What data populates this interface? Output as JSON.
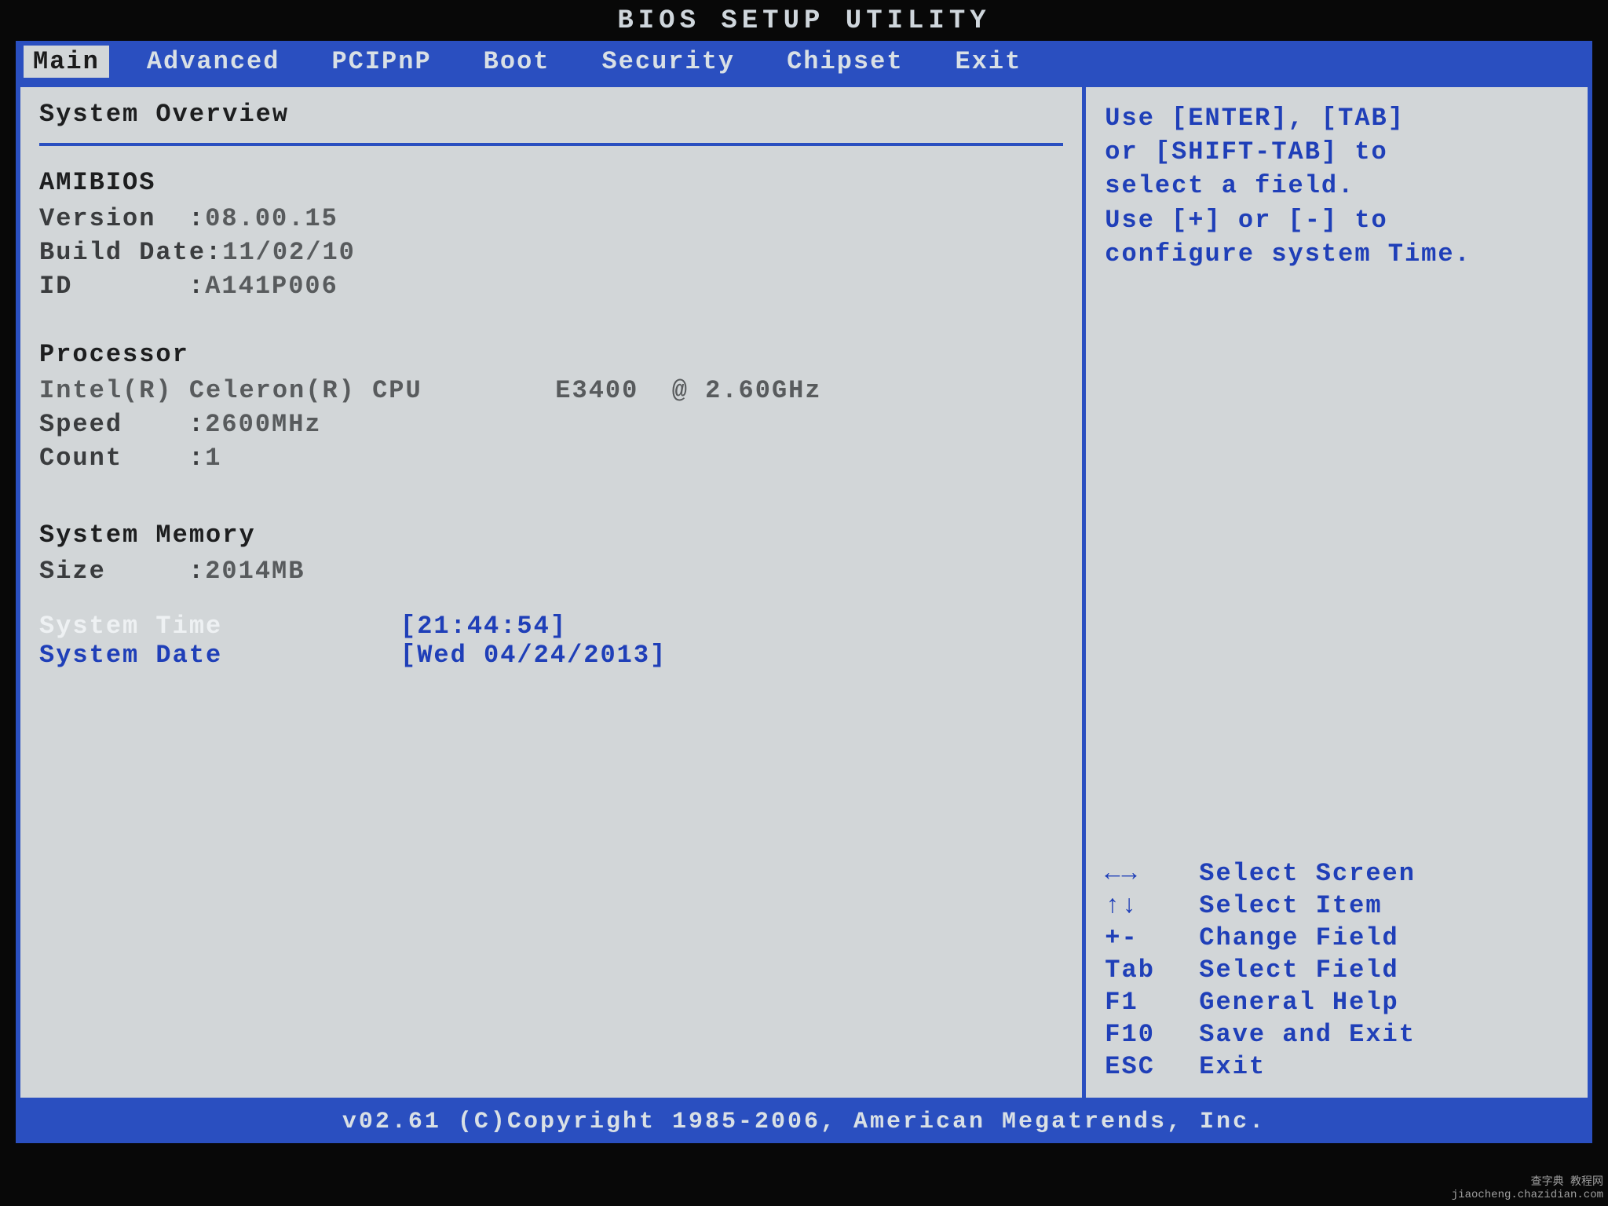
{
  "title": "BIOS SETUP UTILITY",
  "menu": {
    "items": [
      "Main",
      "Advanced",
      "PCIPnP",
      "Boot",
      "Security",
      "Chipset",
      "Exit"
    ],
    "selected_index": 0
  },
  "main": {
    "overview_title": "System Overview",
    "amibios": {
      "heading": "AMIBIOS",
      "version_label": "Version",
      "version": "08.00.15",
      "build_date_label": "Build Date",
      "build_date": "11/02/10",
      "id_label": "ID",
      "id": "A141P006"
    },
    "processor": {
      "heading": "Processor",
      "name_line": "Intel(R) Celeron(R) CPU        E3400  @ 2.60GHz",
      "speed_label": "Speed",
      "speed": "2600MHz",
      "count_label": "Count",
      "count": "1"
    },
    "memory": {
      "heading": "System Memory",
      "size_label": "Size",
      "size": "2014MB"
    },
    "time": {
      "label": "System Time",
      "value": "[21:44:54]"
    },
    "date": {
      "label": "System Date",
      "value": "[Wed 04/24/2013]"
    }
  },
  "help": {
    "top": [
      "Use [ENTER], [TAB]",
      "or [SHIFT-TAB] to",
      "select a field.",
      "",
      "Use [+] or [-] to",
      "configure system Time."
    ],
    "keys": [
      {
        "key": "←→",
        "desc": "Select Screen"
      },
      {
        "key": "↑↓",
        "desc": "Select Item"
      },
      {
        "key": "+-",
        "desc": "Change Field"
      },
      {
        "key": "Tab",
        "desc": "Select Field"
      },
      {
        "key": "F1",
        "desc": "General Help"
      },
      {
        "key": "F10",
        "desc": "Save and Exit"
      },
      {
        "key": "ESC",
        "desc": "Exit"
      }
    ]
  },
  "footer": "v02.61 (C)Copyright 1985-2006, American Megatrends, Inc.",
  "watermark": {
    "line1": "查字典 教程网",
    "line2": "jiaocheng.chazidian.com"
  }
}
